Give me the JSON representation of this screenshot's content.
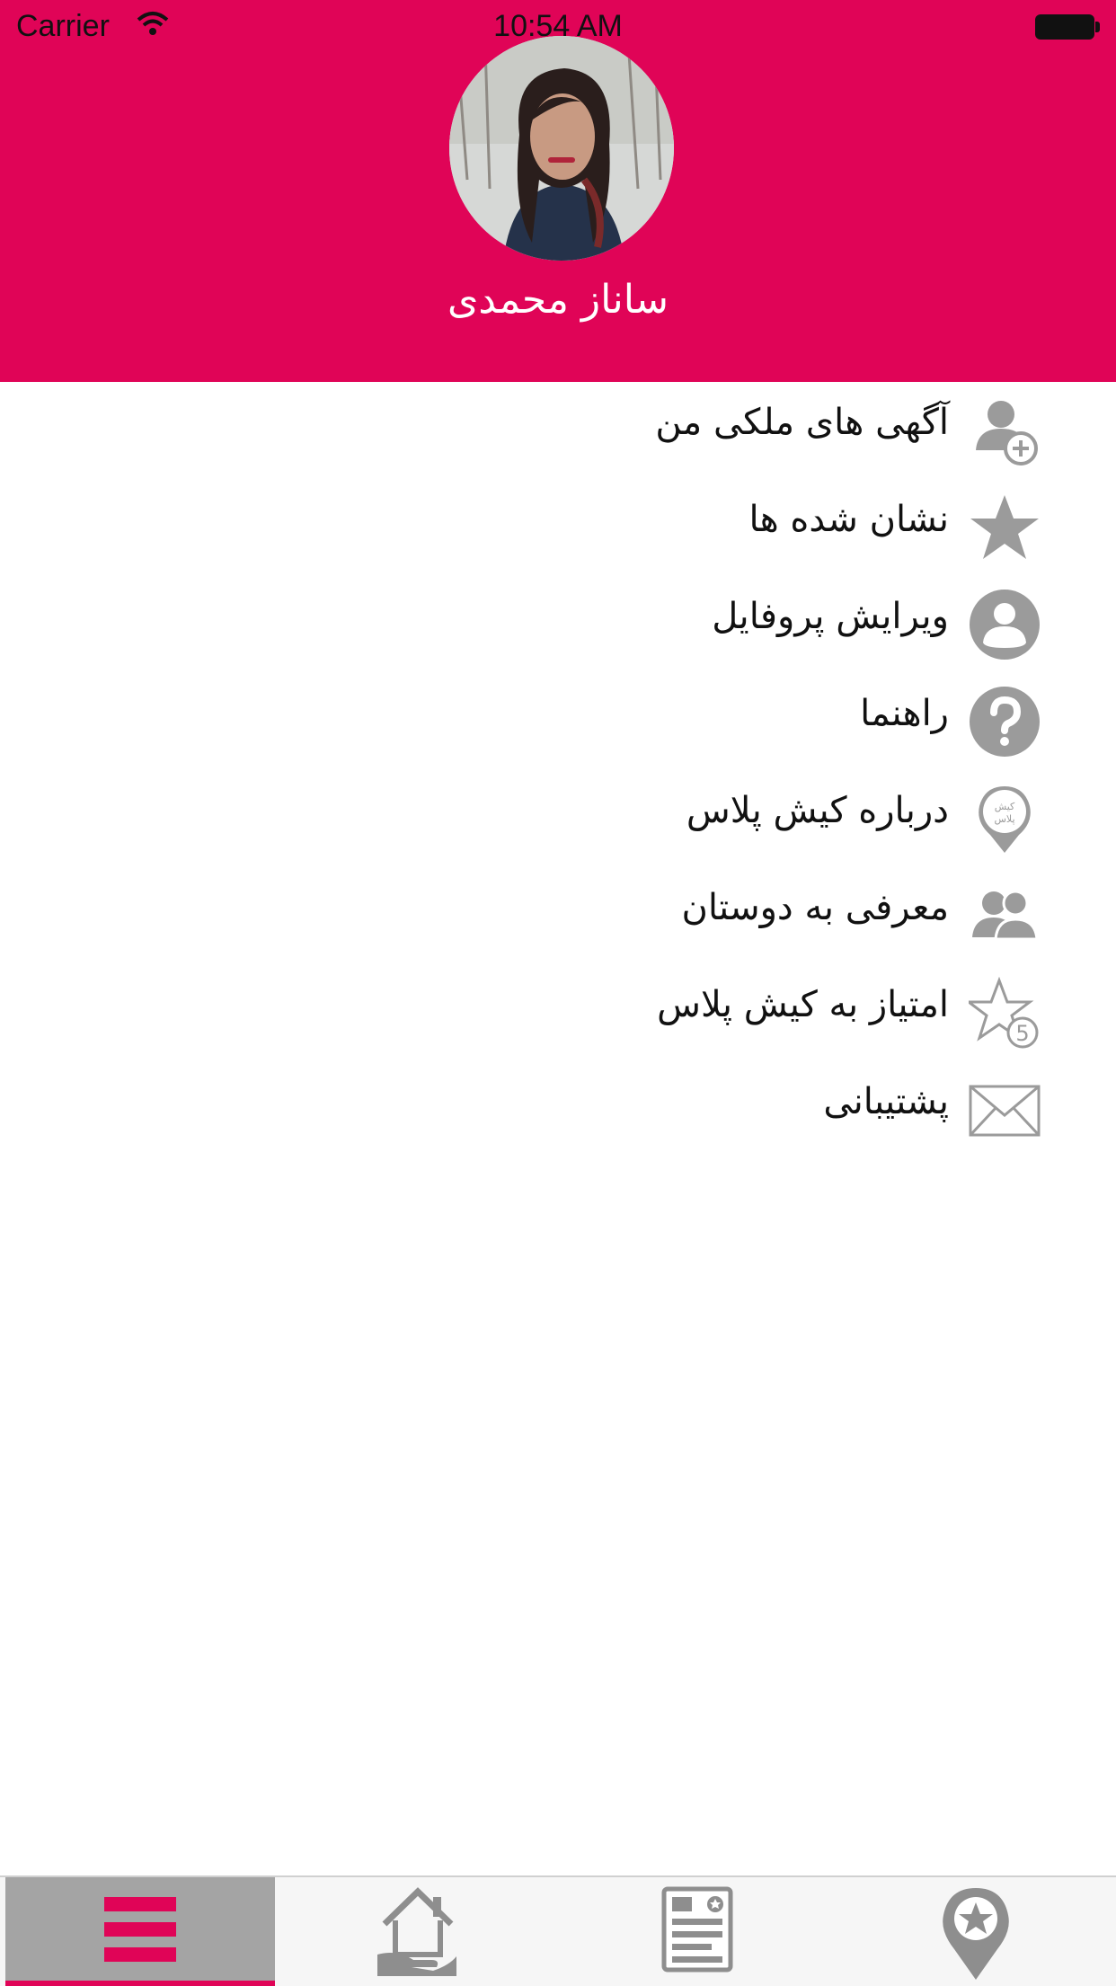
{
  "status_bar": {
    "carrier": "Carrier",
    "time": "10:54 AM"
  },
  "profile": {
    "name": "ساناز محمدی"
  },
  "menu": {
    "items": [
      {
        "label": "آگهی های ملکی من",
        "icon": "person-add-icon"
      },
      {
        "label": "نشان شده ها",
        "icon": "star-icon"
      },
      {
        "label": "ویرایش پروفایل",
        "icon": "user-circle-icon"
      },
      {
        "label": "راهنما",
        "icon": "help-icon"
      },
      {
        "label": "درباره کیش پلاس",
        "icon": "kish-plus-pin-icon",
        "icon_text": "کیش پلاس"
      },
      {
        "label": "معرفی به دوستان",
        "icon": "friends-icon"
      },
      {
        "label": "امتیاز به کیش پلاس",
        "icon": "rate-star-icon",
        "icon_text": "5"
      },
      {
        "label": "پشتیبانی",
        "icon": "mail-icon"
      }
    ]
  },
  "tabbar": {
    "tabs": [
      {
        "name": "menu",
        "icon": "hamburger-icon",
        "active": true
      },
      {
        "name": "home",
        "icon": "house-hand-icon",
        "active": false
      },
      {
        "name": "news",
        "icon": "newspaper-icon",
        "active": false
      },
      {
        "name": "places",
        "icon": "map-pin-star-icon",
        "active": false
      }
    ]
  },
  "colors": {
    "brand": "#e00457",
    "icon_gray": "#9b9b9b",
    "tab_active_bg": "#a4a4a4"
  }
}
